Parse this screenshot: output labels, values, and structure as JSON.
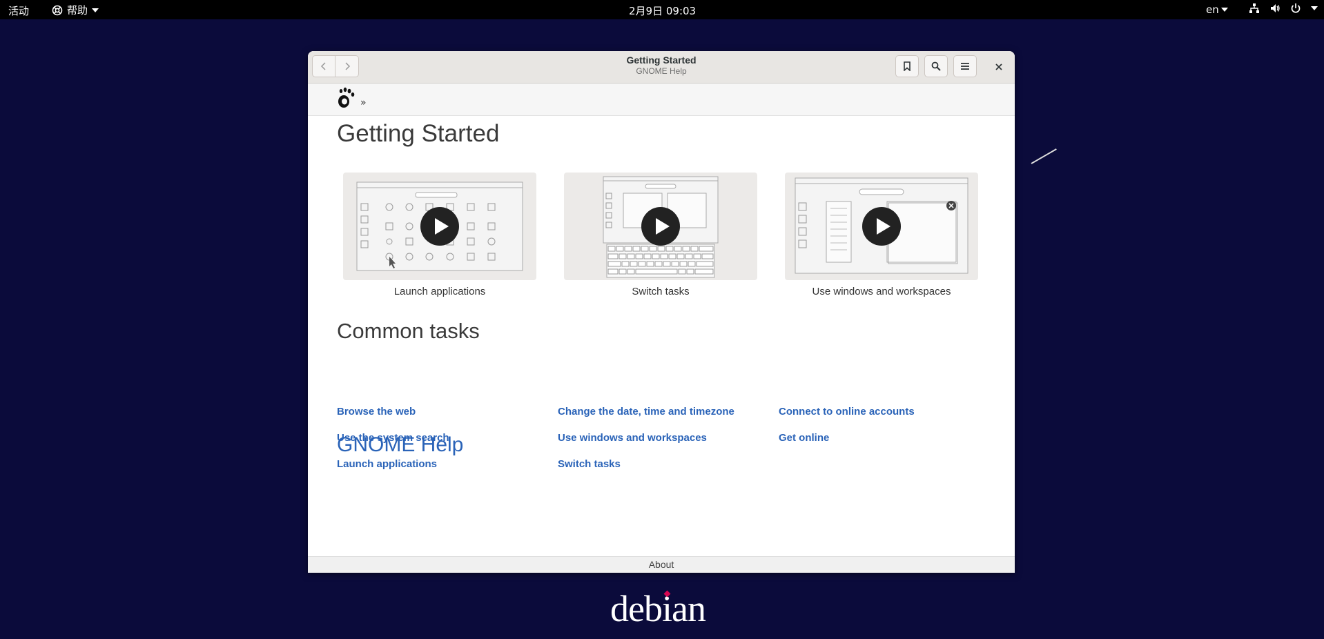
{
  "topbar": {
    "activities": "活动",
    "app_menu": "帮助",
    "clock": "2月9日  09:03",
    "language": "en"
  },
  "window": {
    "title": "Getting Started",
    "subtitle": "GNOME Help",
    "breadcrumb_sep": "»"
  },
  "page": {
    "title": "Getting Started",
    "videos": [
      {
        "caption": "Launch applications"
      },
      {
        "caption": "Switch tasks"
      },
      {
        "caption": "Use windows and workspaces"
      }
    ],
    "common_tasks_heading": "Common tasks",
    "tasks": [
      [
        "Browse the web",
        "Use the system search",
        "Launch applications"
      ],
      [
        "Change the date, time and timezone",
        "Use windows and workspaces",
        "Switch tasks"
      ],
      [
        "Connect to online accounts",
        "Get online"
      ]
    ],
    "gnome_help_link": "GNOME Help",
    "about": "About"
  },
  "desktop": {
    "logo_text": "debian"
  },
  "colors": {
    "link": "#2a63b8",
    "desktop_bg": "#0b0b3b",
    "debian_red": "#d70751"
  }
}
